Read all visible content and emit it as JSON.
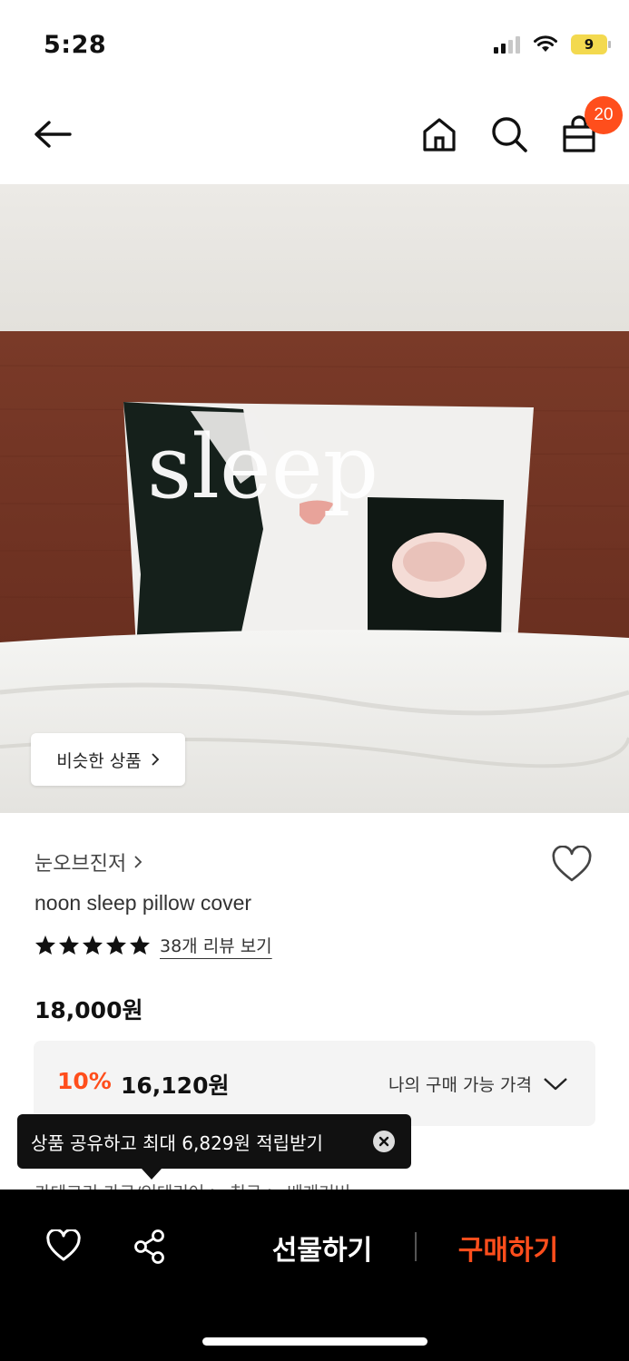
{
  "status_bar": {
    "time": "5:28",
    "battery_level": "9",
    "icons": [
      "signal-icon",
      "wifi-icon",
      "battery-icon"
    ]
  },
  "top_nav": {
    "icons": [
      "back-arrow-icon",
      "home-icon",
      "search-icon",
      "shopping-bag-icon"
    ],
    "cart_count": "20"
  },
  "hero": {
    "image_text": "sleep",
    "similar_button_label": "비슷한 상품",
    "similar_button_icon": "chevron-right-icon"
  },
  "product": {
    "brand": "눈오브진저",
    "name": "noon sleep pillow cover",
    "rating_stars": 5,
    "review_link": "38개 리뷰 보기",
    "price": "18,000원",
    "discount": "10%",
    "sale_price": "16,120원",
    "my_price_label": "나의 구매 가능 가격"
  },
  "category_peek": "카테고리      가구/인테리어 > 침구 > 베개커버",
  "tooltip": {
    "text": "상품 공유하고 최대 6,829원 적립받기"
  },
  "bottom_bar": {
    "gift_label": "선물하기",
    "buy_label": "구매하기"
  },
  "colors": {
    "accent": "#ff4e1c",
    "bottom_bar": "#000000",
    "price_box": "#f4f4f4"
  }
}
